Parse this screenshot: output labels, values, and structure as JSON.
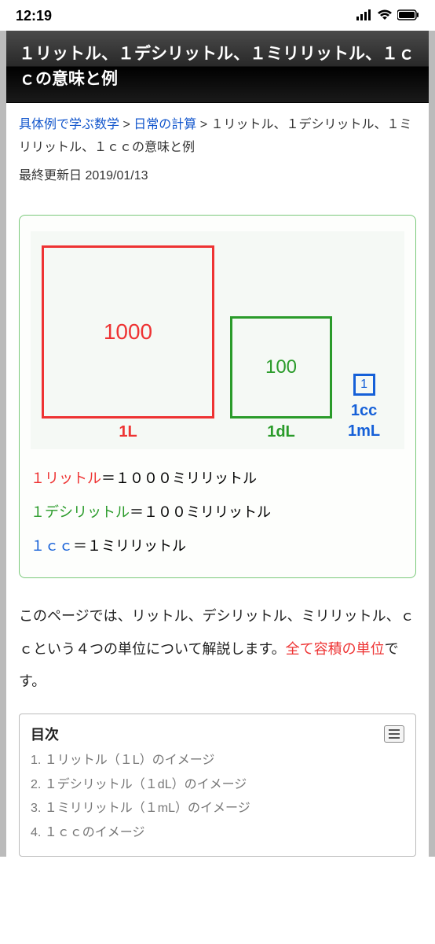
{
  "status": {
    "time": "12:19"
  },
  "header": {
    "title": "１リットル、１デシリットル、１ミリリットル、１ｃｃの意味と例"
  },
  "breadcrumb": {
    "link1": "具体例で学ぶ数学",
    "sep1": " > ",
    "link2": "日常の計算",
    "sep2": " > ",
    "current": "１リットル、１デシリットル、１ミリリットル、１ｃｃの意味と例"
  },
  "updated": {
    "label": "最終更新日 ",
    "date": "2019/01/13"
  },
  "diagram": {
    "large": {
      "value": "1000",
      "label": "1L"
    },
    "med": {
      "value": "100",
      "label": "1dL"
    },
    "small": {
      "value": "1",
      "label1": "1cc",
      "label2": "1mL"
    },
    "eq1": {
      "left": "１リットル",
      "rest": "＝１０００ミリリットル"
    },
    "eq2": {
      "left": "１デシリットル",
      "rest": "＝１００ミリリットル"
    },
    "eq3": {
      "left": "１ｃｃ",
      "rest": "＝１ミリリットル"
    }
  },
  "body": {
    "part1": "このページでは、リットル、デシリットル、ミリリットル、ｃｃという４つの単位について解説します。",
    "highlight": "全て容積の単位",
    "part2": "です。"
  },
  "toc": {
    "title": "目次",
    "items": [
      {
        "num": "1.",
        "text": "１リットル（１L）のイメージ"
      },
      {
        "num": "2.",
        "text": "１デシリットル（１dL）のイメージ"
      },
      {
        "num": "3.",
        "text": "１ミリリットル（１mL）のイメージ"
      },
      {
        "num": "4.",
        "text": "１ｃｃのイメージ"
      }
    ]
  }
}
